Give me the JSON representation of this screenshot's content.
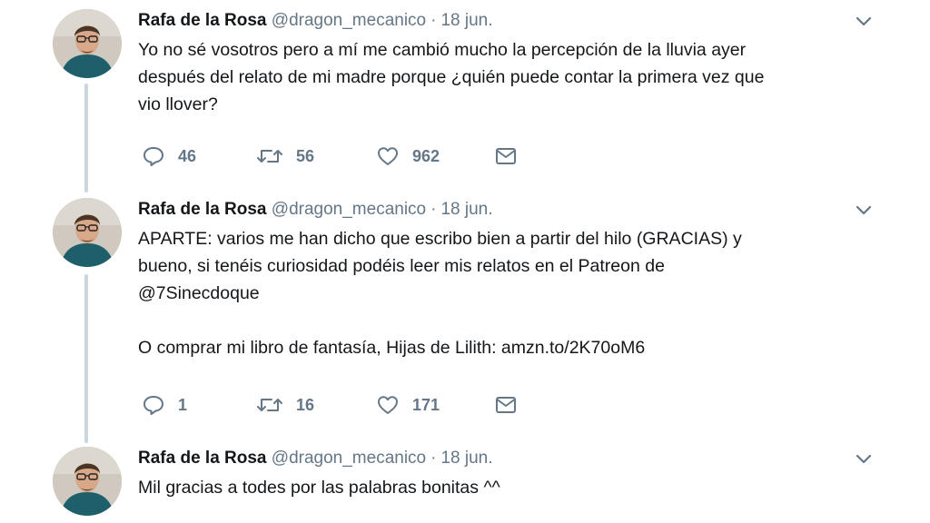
{
  "tweets": [
    {
      "name": "Rafa de la Rosa",
      "handle": "@dragon_mecanico",
      "separator": "·",
      "date": "18 jun.",
      "text": "Yo no sé vosotros pero a mí me cambió mucho la percepción de la lluvia ayer\ndespués del relato de mi madre porque ¿quién puede contar la primera vez que\nvio llover?",
      "replies": "46",
      "retweets": "56",
      "likes": "962"
    },
    {
      "name": "Rafa de la Rosa",
      "handle": "@dragon_mecanico",
      "separator": "·",
      "date": "18 jun.",
      "text": "APARTE: varios me han dicho que escribo bien a partir del hilo (GRACIAS) y\nbueno, si tenéis curiosidad podéis leer mis relatos en el Patreon de\n@7Sinecdoque\n\nO comprar mi libro de fantasía, Hijas de Lilith: amzn.to/2K70oM6",
      "replies": "1",
      "retweets": "16",
      "likes": "171"
    },
    {
      "name": "Rafa de la Rosa",
      "handle": "@dragon_mecanico",
      "separator": "·",
      "date": "18 jun.",
      "text": "Mil gracias a todes por las palabras bonitas ^^"
    }
  ],
  "icons": {
    "reply": "reply-icon",
    "retweet": "retweet-icon",
    "like": "heart-icon",
    "dm": "envelope-icon",
    "menu": "chevron-down-icon"
  },
  "colors": {
    "text": "#14171a",
    "secondary": "#657786",
    "thread_line": "#ccd6dd"
  }
}
